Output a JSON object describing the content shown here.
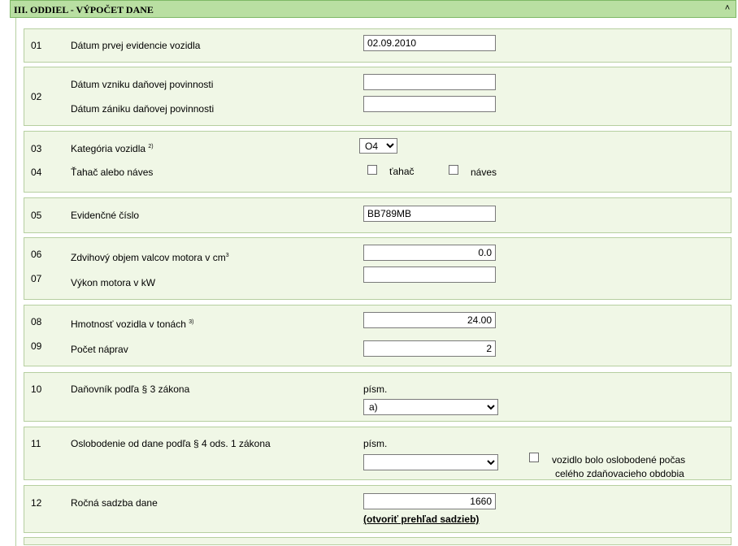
{
  "header": {
    "title": "III. ODDIEL - VÝPOČET DANE",
    "collapse_glyph": "˄"
  },
  "rows": {
    "r01": {
      "num": "01",
      "label": "Dátum prvej evidencie vozidla",
      "value": "02.09.2010"
    },
    "r02": {
      "num": "02",
      "label_a": "Dátum vzniku daňovej povinnosti",
      "label_b": "Dátum zániku daňovej povinnosti",
      "value_a": "",
      "value_b": ""
    },
    "r03": {
      "num": "03",
      "label": "Kategória vozidla",
      "sup": "2)",
      "selected": "O4"
    },
    "r04": {
      "num": "04",
      "label": "Ťahač alebo náves",
      "opt1": "ťahač",
      "opt2": "náves"
    },
    "r05": {
      "num": "05",
      "label": "Evidenčné číslo",
      "value": "BB789MB"
    },
    "r06": {
      "num": "06",
      "label": "Zdvihový objem valcov motora v cm",
      "sup": "3",
      "value": "0.0"
    },
    "r07": {
      "num": "07",
      "label": "Výkon motora v kW",
      "value": ""
    },
    "r08": {
      "num": "08",
      "label": "Hmotnosť vozidla v tonách",
      "sup": "3)",
      "value": "24.00"
    },
    "r09": {
      "num": "09",
      "label": "Počet náprav",
      "value": "2"
    },
    "r10": {
      "num": "10",
      "label": "Daňovník podľa § 3 zákona",
      "pism": "písm.",
      "selected": "a)"
    },
    "r11": {
      "num": "11",
      "label": "Oslobodenie od dane podľa § 4 ods. 1 zákona",
      "pism": "písm.",
      "selected": "",
      "check_line1": "vozidlo bolo oslobodené počas",
      "check_line2": "celého zdaňovacieho obdobia"
    },
    "r12": {
      "num": "12",
      "label": "Ročná sadzba dane",
      "value": "1660",
      "link": "(otvoriť prehľad sadzieb)"
    }
  }
}
